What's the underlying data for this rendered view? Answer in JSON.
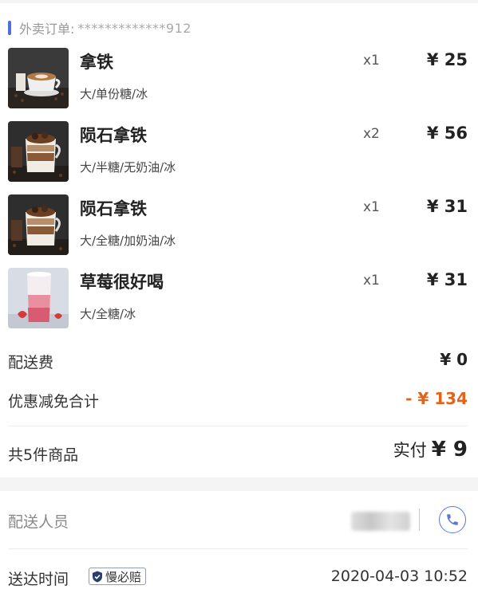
{
  "order": {
    "header_label": "外卖订单:",
    "order_number": "*************912"
  },
  "items": [
    {
      "name": "拿铁",
      "spec": "大/单份糖/冰",
      "qty": "x1",
      "price": "¥ 25",
      "image": "latte-image"
    },
    {
      "name": "陨石拿铁",
      "spec": "大/半糖/无奶油/冰",
      "qty": "x2",
      "price": "¥ 56",
      "image": "meteorite-latte-image"
    },
    {
      "name": "陨石拿铁",
      "spec": "大/全糖/加奶油/冰",
      "qty": "x1",
      "price": "¥ 31",
      "image": "meteorite-latte-image"
    },
    {
      "name": "草莓很好喝",
      "spec": "大/全糖/冰",
      "qty": "x1",
      "price": "¥ 31",
      "image": "strawberry-drink-image"
    }
  ],
  "summary": {
    "delivery_fee_label": "配送费",
    "delivery_fee_value": "¥ 0",
    "discount_label": "优惠减免合计",
    "discount_value": "- ¥ 134",
    "total_items_label": "共5件商品",
    "paid_label": "实付",
    "paid_value": "¥ 9"
  },
  "delivery": {
    "courier_label": "配送人员",
    "arrive_label": "送达时间",
    "badge_label": "慢必赔",
    "arrive_time": "2020-04-03 10:52"
  },
  "colors": {
    "accent": "#4f6fd8",
    "discount": "#e2641a"
  },
  "icons": [
    "phone-icon",
    "shield-check-icon"
  ]
}
